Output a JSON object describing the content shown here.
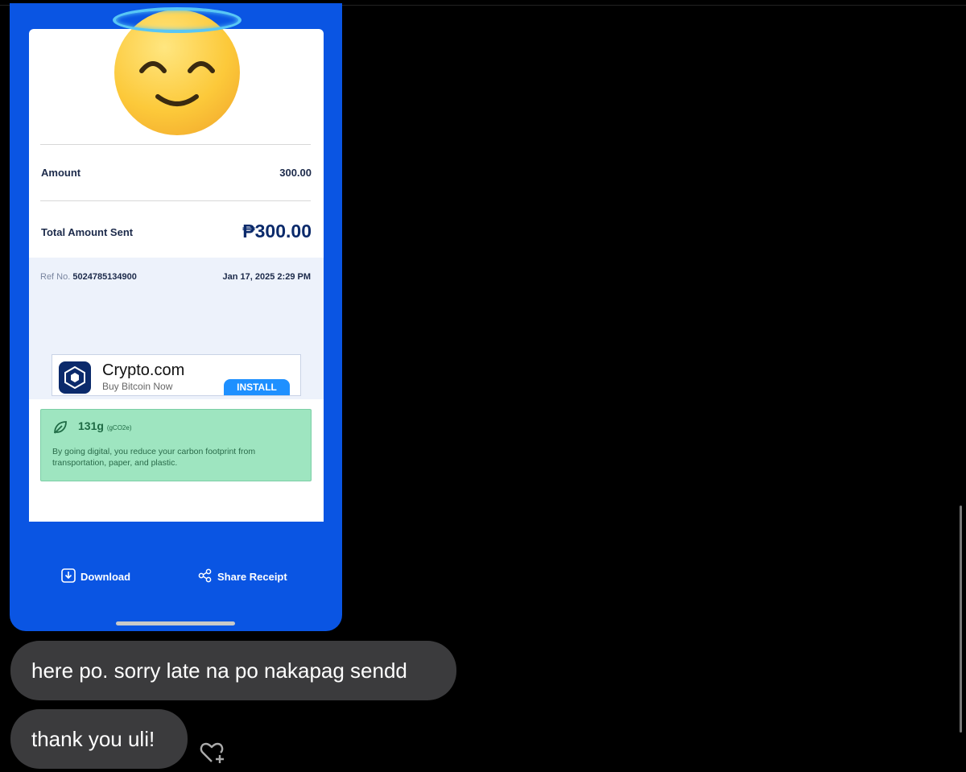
{
  "receipt": {
    "amount_label": "Amount",
    "amount_value": "300.00",
    "total_label": "Total Amount Sent",
    "total_value": "₱300.00",
    "ref_prefix": "Ref No.",
    "ref_number": "5024785134900",
    "date": "Jan 17, 2025 2:29 PM"
  },
  "ad": {
    "title": "Crypto.com",
    "subtitle": "Buy Bitcoin Now",
    "button": "INSTALL"
  },
  "eco": {
    "value": "131g",
    "unit": "(gCO2e)",
    "text": "By going digital, you reduce your carbon footprint from transportation, paper, and plastic."
  },
  "actions": {
    "download": "Download",
    "share": "Share Receipt"
  },
  "messages": [
    {
      "text": "here po. sorry late na po nakapag sendd"
    },
    {
      "text": "thank you uli!"
    }
  ],
  "colors": {
    "brand_blue": "#0a55e3",
    "bubble": "#3b3b3d",
    "eco_green": "#9ee5c0"
  },
  "icons": {
    "emoji": "smiling-face-with-halo-icon",
    "react": "heart-plus-icon"
  }
}
